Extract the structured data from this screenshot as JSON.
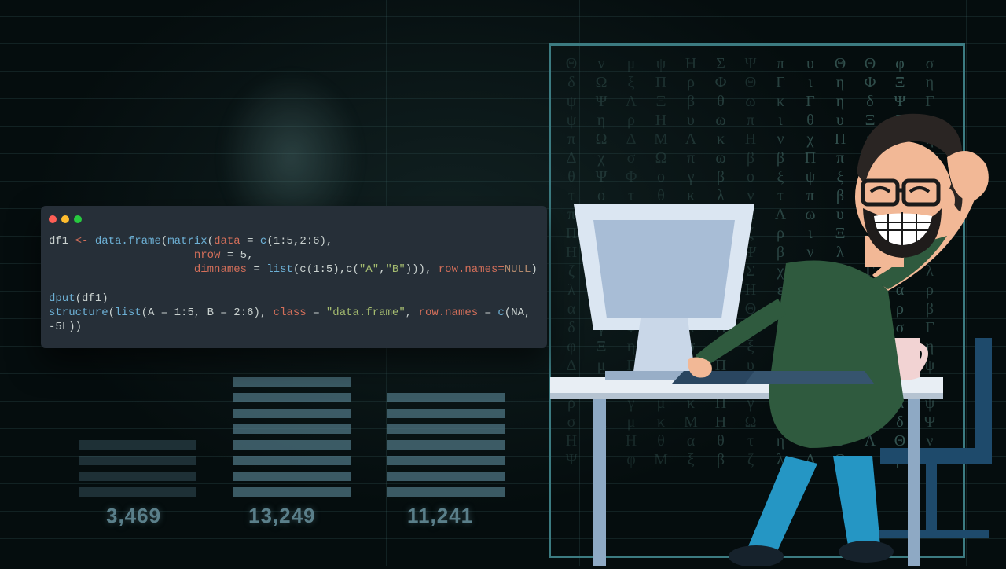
{
  "terminal": {
    "lines": {
      "l1_var": "df1",
      "l1_assign": " <- ",
      "l1_fn": "data.frame",
      "l1_paren1": "(",
      "l1_matrix": "matrix",
      "l1_paren2": "(",
      "l1_arg_data": "data",
      "l1_eq": " = ",
      "l1_c": "c",
      "l1_vals": "(1:5,2:6),",
      "l2_indent": "                      ",
      "l2_arg": "nrow",
      "l2_eq": " = ",
      "l2_val": "5,",
      "l3_indent": "                      ",
      "l3_arg": "dimnames",
      "l3_eq": " = ",
      "l3_list": "list",
      "l3_rest": "(c(1:5),c(",
      "l3_strA": "\"A\"",
      "l3_comma": ",",
      "l3_strB": "\"B\"",
      "l3_close": "))), ",
      "l3_rownames": "row.names=",
      "l3_null": "NULL",
      "l3_end": ")",
      "l5_fn": "dput",
      "l5_arg": "(df1)",
      "l6_fn": "structure",
      "l6_open": "(",
      "l6_list": "list",
      "l6_A": "(A = 1:5, B = 2:6), ",
      "l6_class": "class",
      "l6_eq": " = ",
      "l6_classval": "\"data.frame\"",
      "l6_comma": ", ",
      "l6_rn": "row.names",
      "l6_eq2": " = ",
      "l6_c": "c",
      "l6_na": "(NA,",
      "l7_val": "-5L))"
    }
  },
  "chart_data": {
    "type": "bar",
    "note": "decorative background bars; labels are displayed numbers underneath",
    "categories": [
      "3,469",
      "13,249",
      "11,241"
    ],
    "values": [
      4,
      8,
      7
    ],
    "labels": [
      "3,469",
      "13,249",
      "11,241"
    ]
  },
  "matrix_glyphs": "ΜΦΗΣΛΞΩΨΓΔΠΘαβγδεζηθικλμνξοπρστυφχψω"
}
